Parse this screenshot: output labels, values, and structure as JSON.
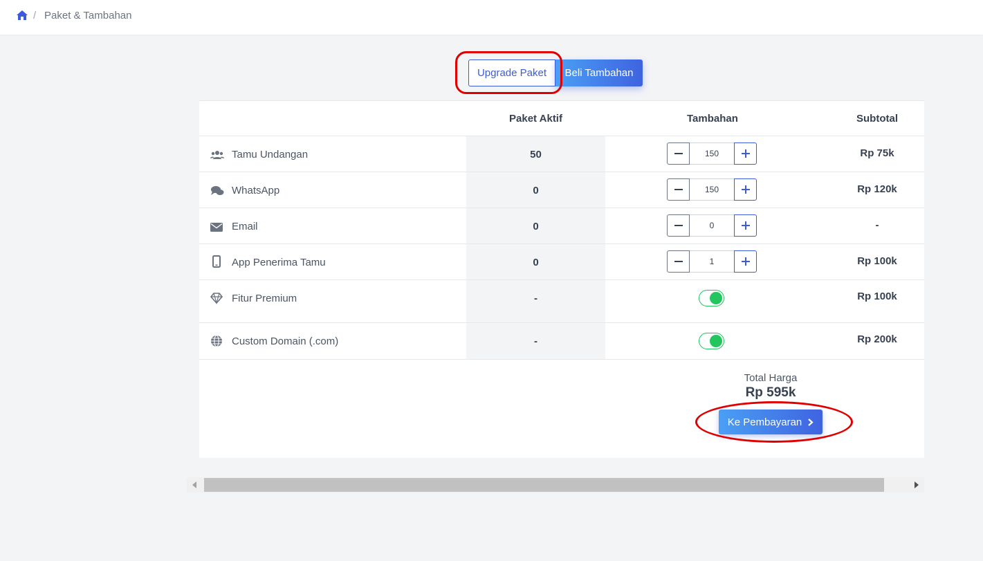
{
  "breadcrumb": {
    "home_icon": "home-icon",
    "separator": "/",
    "current": "Paket & Tambahan"
  },
  "tabs": {
    "upgrade_label": "Upgrade Paket",
    "beli_label": "Beli Tambahan",
    "active": "Beli Tambahan"
  },
  "table": {
    "headers": {
      "active": "Paket Aktif",
      "addon": "Tambahan",
      "subtotal": "Subtotal"
    },
    "rows": [
      {
        "icon": "users-icon",
        "label": "Tamu Undangan",
        "active": "50",
        "control": "stepper",
        "qty": "150",
        "subtotal": "Rp 75k"
      },
      {
        "icon": "chat-icon",
        "label": "WhatsApp",
        "active": "0",
        "control": "stepper",
        "qty": "150",
        "subtotal": "Rp 120k"
      },
      {
        "icon": "envelope-icon",
        "label": "Email",
        "active": "0",
        "control": "stepper",
        "qty": "0",
        "subtotal": "-"
      },
      {
        "icon": "mobile-icon",
        "label": "App Penerima Tamu",
        "active": "0",
        "control": "stepper",
        "qty": "1",
        "subtotal": "Rp 100k"
      },
      {
        "icon": "diamond-icon",
        "label": "Fitur Premium",
        "active": "-",
        "control": "toggle",
        "enabled": true,
        "subtotal": "Rp 100k"
      },
      {
        "icon": "globe-icon",
        "label": "Custom Domain (.com)",
        "active": "-",
        "control": "toggle",
        "enabled": true,
        "subtotal": "Rp 200k"
      }
    ]
  },
  "total": {
    "label": "Total Harga",
    "value": "Rp 595k"
  },
  "pay_button": {
    "label": "Ke Pembayaran",
    "icon": "chevron-right-icon"
  },
  "colors": {
    "accent": "#3b5bdb",
    "toggle_on": "#22c55e",
    "annotation": "#e00000"
  }
}
